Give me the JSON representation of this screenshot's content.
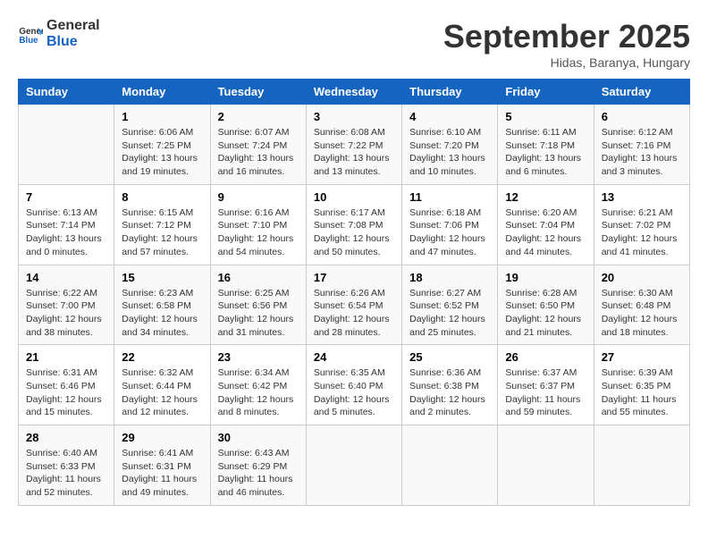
{
  "header": {
    "logo_line1": "General",
    "logo_line2": "Blue",
    "month": "September 2025",
    "location": "Hidas, Baranya, Hungary"
  },
  "weekdays": [
    "Sunday",
    "Monday",
    "Tuesday",
    "Wednesday",
    "Thursday",
    "Friday",
    "Saturday"
  ],
  "weeks": [
    [
      {
        "day": "",
        "empty": true
      },
      {
        "day": "1",
        "sunrise": "6:06 AM",
        "sunset": "7:25 PM",
        "daylight": "13 hours and 19 minutes."
      },
      {
        "day": "2",
        "sunrise": "6:07 AM",
        "sunset": "7:24 PM",
        "daylight": "13 hours and 16 minutes."
      },
      {
        "day": "3",
        "sunrise": "6:08 AM",
        "sunset": "7:22 PM",
        "daylight": "13 hours and 13 minutes."
      },
      {
        "day": "4",
        "sunrise": "6:10 AM",
        "sunset": "7:20 PM",
        "daylight": "13 hours and 10 minutes."
      },
      {
        "day": "5",
        "sunrise": "6:11 AM",
        "sunset": "7:18 PM",
        "daylight": "13 hours and 6 minutes."
      },
      {
        "day": "6",
        "sunrise": "6:12 AM",
        "sunset": "7:16 PM",
        "daylight": "13 hours and 3 minutes."
      }
    ],
    [
      {
        "day": "7",
        "sunrise": "6:13 AM",
        "sunset": "7:14 PM",
        "daylight": "13 hours and 0 minutes."
      },
      {
        "day": "8",
        "sunrise": "6:15 AM",
        "sunset": "7:12 PM",
        "daylight": "12 hours and 57 minutes."
      },
      {
        "day": "9",
        "sunrise": "6:16 AM",
        "sunset": "7:10 PM",
        "daylight": "12 hours and 54 minutes."
      },
      {
        "day": "10",
        "sunrise": "6:17 AM",
        "sunset": "7:08 PM",
        "daylight": "12 hours and 50 minutes."
      },
      {
        "day": "11",
        "sunrise": "6:18 AM",
        "sunset": "7:06 PM",
        "daylight": "12 hours and 47 minutes."
      },
      {
        "day": "12",
        "sunrise": "6:20 AM",
        "sunset": "7:04 PM",
        "daylight": "12 hours and 44 minutes."
      },
      {
        "day": "13",
        "sunrise": "6:21 AM",
        "sunset": "7:02 PM",
        "daylight": "12 hours and 41 minutes."
      }
    ],
    [
      {
        "day": "14",
        "sunrise": "6:22 AM",
        "sunset": "7:00 PM",
        "daylight": "12 hours and 38 minutes."
      },
      {
        "day": "15",
        "sunrise": "6:23 AM",
        "sunset": "6:58 PM",
        "daylight": "12 hours and 34 minutes."
      },
      {
        "day": "16",
        "sunrise": "6:25 AM",
        "sunset": "6:56 PM",
        "daylight": "12 hours and 31 minutes."
      },
      {
        "day": "17",
        "sunrise": "6:26 AM",
        "sunset": "6:54 PM",
        "daylight": "12 hours and 28 minutes."
      },
      {
        "day": "18",
        "sunrise": "6:27 AM",
        "sunset": "6:52 PM",
        "daylight": "12 hours and 25 minutes."
      },
      {
        "day": "19",
        "sunrise": "6:28 AM",
        "sunset": "6:50 PM",
        "daylight": "12 hours and 21 minutes."
      },
      {
        "day": "20",
        "sunrise": "6:30 AM",
        "sunset": "6:48 PM",
        "daylight": "12 hours and 18 minutes."
      }
    ],
    [
      {
        "day": "21",
        "sunrise": "6:31 AM",
        "sunset": "6:46 PM",
        "daylight": "12 hours and 15 minutes."
      },
      {
        "day": "22",
        "sunrise": "6:32 AM",
        "sunset": "6:44 PM",
        "daylight": "12 hours and 12 minutes."
      },
      {
        "day": "23",
        "sunrise": "6:34 AM",
        "sunset": "6:42 PM",
        "daylight": "12 hours and 8 minutes."
      },
      {
        "day": "24",
        "sunrise": "6:35 AM",
        "sunset": "6:40 PM",
        "daylight": "12 hours and 5 minutes."
      },
      {
        "day": "25",
        "sunrise": "6:36 AM",
        "sunset": "6:38 PM",
        "daylight": "12 hours and 2 minutes."
      },
      {
        "day": "26",
        "sunrise": "6:37 AM",
        "sunset": "6:37 PM",
        "daylight": "11 hours and 59 minutes."
      },
      {
        "day": "27",
        "sunrise": "6:39 AM",
        "sunset": "6:35 PM",
        "daylight": "11 hours and 55 minutes."
      }
    ],
    [
      {
        "day": "28",
        "sunrise": "6:40 AM",
        "sunset": "6:33 PM",
        "daylight": "11 hours and 52 minutes."
      },
      {
        "day": "29",
        "sunrise": "6:41 AM",
        "sunset": "6:31 PM",
        "daylight": "11 hours and 49 minutes."
      },
      {
        "day": "30",
        "sunrise": "6:43 AM",
        "sunset": "6:29 PM",
        "daylight": "11 hours and 46 minutes."
      },
      {
        "day": "",
        "empty": true
      },
      {
        "day": "",
        "empty": true
      },
      {
        "day": "",
        "empty": true
      },
      {
        "day": "",
        "empty": true
      }
    ]
  ]
}
